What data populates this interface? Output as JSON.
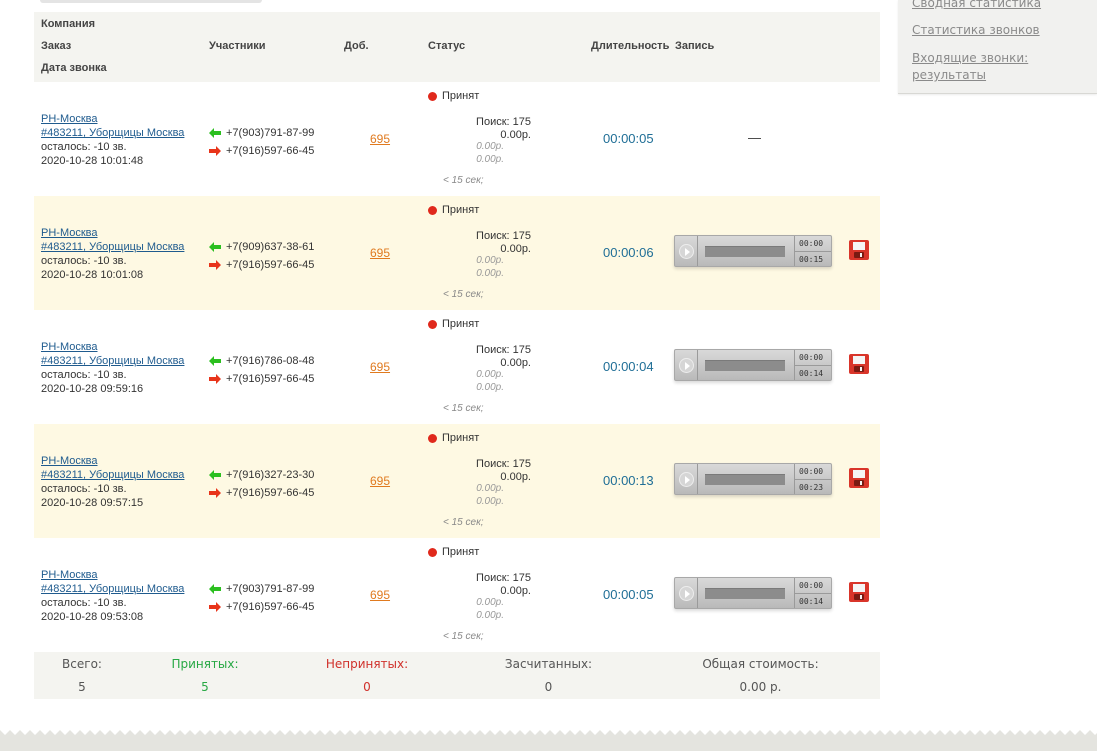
{
  "sidebar": {
    "links": [
      "Сводная статистика",
      "Статистика звонков",
      "Входящие звонки:",
      "результаты"
    ]
  },
  "table": {
    "headers": {
      "company": "Компания",
      "order": "Заказ",
      "date": "Дата звонка",
      "participants": "Участники",
      "ext": "Доб.",
      "status": "Статус",
      "duration": "Длительность",
      "record": "Запись"
    },
    "rows": [
      {
        "company": "РН-Москва",
        "order": "#483211, Уборщицы Москва",
        "remaining": "осталось: -10 зв.",
        "date": "2020-10-28 10:01:48",
        "caller": "+7(903)791-87-99",
        "callee": "+7(916)597-66-45",
        "ext": "695",
        "status": "Принят",
        "search": "Поиск: 175",
        "price": "0.00р.",
        "price2": "0.00р.",
        "price3": "0.00р.",
        "short": "< 15 сек;",
        "duration": "00:00:05",
        "record": "—",
        "player_current": "",
        "player_total": ""
      },
      {
        "company": "РН-Москва",
        "order": "#483211, Уборщицы Москва",
        "remaining": "осталось: -10 зв.",
        "date": "2020-10-28 10:01:08",
        "caller": "+7(909)637-38-61",
        "callee": "+7(916)597-66-45",
        "ext": "695",
        "status": "Принят",
        "search": "Поиск: 175",
        "price": "0.00р.",
        "price2": "0.00р.",
        "price3": "0.00р.",
        "short": "< 15 сек;",
        "duration": "00:00:06",
        "record": "",
        "player_current": "00:00",
        "player_total": "00:15"
      },
      {
        "company": "РН-Москва",
        "order": "#483211, Уборщицы Москва",
        "remaining": "осталось: -10 зв.",
        "date": "2020-10-28 09:59:16",
        "caller": "+7(916)786-08-48",
        "callee": "+7(916)597-66-45",
        "ext": "695",
        "status": "Принят",
        "search": "Поиск: 175",
        "price": "0.00р.",
        "price2": "0.00р.",
        "price3": "0.00р.",
        "short": "< 15 сек;",
        "duration": "00:00:04",
        "record": "",
        "player_current": "00:00",
        "player_total": "00:14"
      },
      {
        "company": "РН-Москва",
        "order": "#483211, Уборщицы Москва",
        "remaining": "осталось: -10 зв.",
        "date": "2020-10-28 09:57:15",
        "caller": "+7(916)327-23-30",
        "callee": "+7(916)597-66-45",
        "ext": "695",
        "status": "Принят",
        "search": "Поиск: 175",
        "price": "0.00р.",
        "price2": "0.00р.",
        "price3": "0.00р.",
        "short": "< 15 сек;",
        "duration": "00:00:13",
        "record": "",
        "player_current": "00:00",
        "player_total": "00:23"
      },
      {
        "company": "РН-Москва",
        "order": "#483211, Уборщицы Москва",
        "remaining": "осталось: -10 зв.",
        "date": "2020-10-28 09:53:08",
        "caller": "+7(903)791-87-99",
        "callee": "+7(916)597-66-45",
        "ext": "695",
        "status": "Принят",
        "search": "Поиск: 175",
        "price": "0.00р.",
        "price2": "0.00р.",
        "price3": "0.00р.",
        "short": "< 15 сек;",
        "duration": "00:00:05",
        "record": "",
        "player_current": "00:00",
        "player_total": "00:14"
      }
    ]
  },
  "summary": {
    "total_label": "Всего:",
    "total_value": "5",
    "accepted_label": "Принятых:",
    "accepted_value": "5",
    "missed_label": "Непринятых:",
    "missed_value": "0",
    "counted_label": "Засчитанных:",
    "counted_value": "0",
    "cost_label": "Общая стоимость:",
    "cost_value": "0.00 р."
  },
  "colors": {
    "accepted": "#27a844",
    "missed": "#d0302a",
    "link": "#1f5b8e",
    "ext": "#e07a1f",
    "duration": "#1f6e96",
    "row_highlight": "#fef9e3",
    "status_dot": "#e0291c"
  },
  "icons": {
    "incoming": "green-arrow-left-icon",
    "outgoing": "red-arrow-right-icon",
    "status": "red-dot-icon",
    "play": "play-icon",
    "save": "floppy-disk-icon"
  }
}
